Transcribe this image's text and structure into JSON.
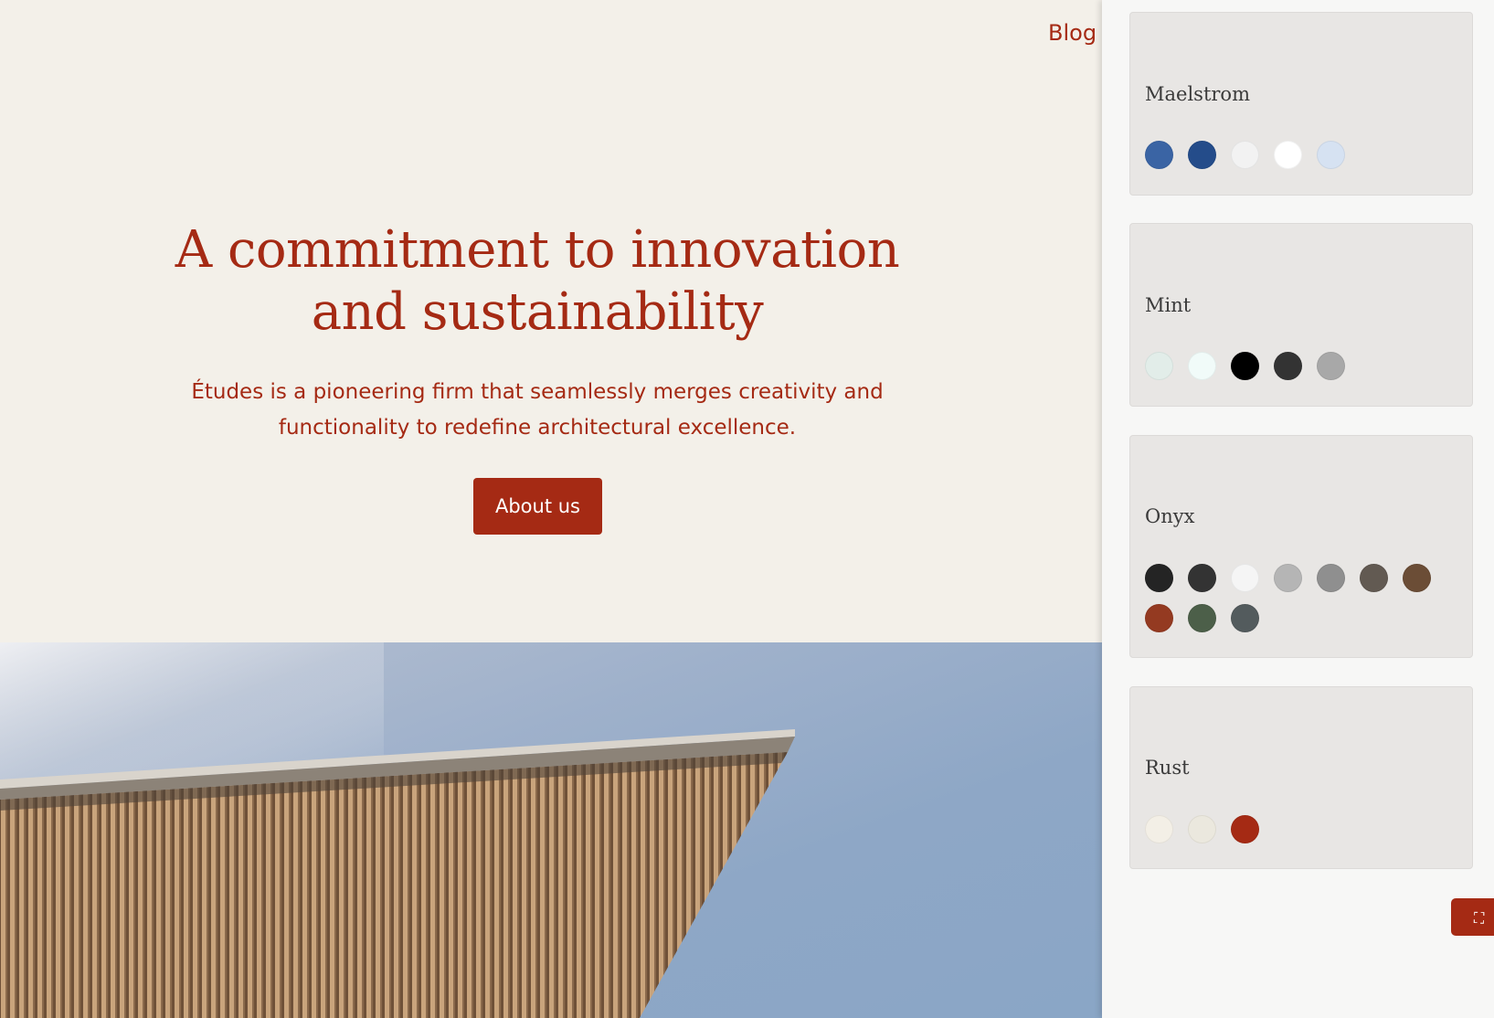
{
  "nav": {
    "blog_label": "Blog"
  },
  "hero": {
    "heading_line1": "A commitment to innovation",
    "heading_line2": "and sustainability",
    "description_line1": "Études is a pioneering firm that seamlessly merges creativity and",
    "description_line2": "functionality to redefine architectural excellence.",
    "button_label": "About us"
  },
  "style_panel": {
    "palettes": [
      {
        "name": "Maelstrom",
        "colors": [
          "#3a64a4",
          "#244c8a",
          "#f2f2f2",
          "#ffffff",
          "#d6e2f2"
        ]
      },
      {
        "name": "Mint",
        "colors": [
          "#e2ede9",
          "#f1fbf9",
          "#000000",
          "#333333",
          "#a8a8a8"
        ]
      },
      {
        "name": "Onyx",
        "colors": [
          "#242424",
          "#333333",
          "#f5f5f5",
          "#b5b5b5",
          "#8f8f8f",
          "#625a52",
          "#6b4d36",
          "#943a21",
          "#4c5f49",
          "#535b5d"
        ]
      },
      {
        "name": "Rust",
        "colors": [
          "#f3efe6",
          "#ebe8de",
          "#a52a14"
        ]
      }
    ]
  },
  "fullscreen_icon": "fullscreen-icon",
  "colors": {
    "accent": "#a52a14",
    "page_background": "#f3f0e9"
  }
}
